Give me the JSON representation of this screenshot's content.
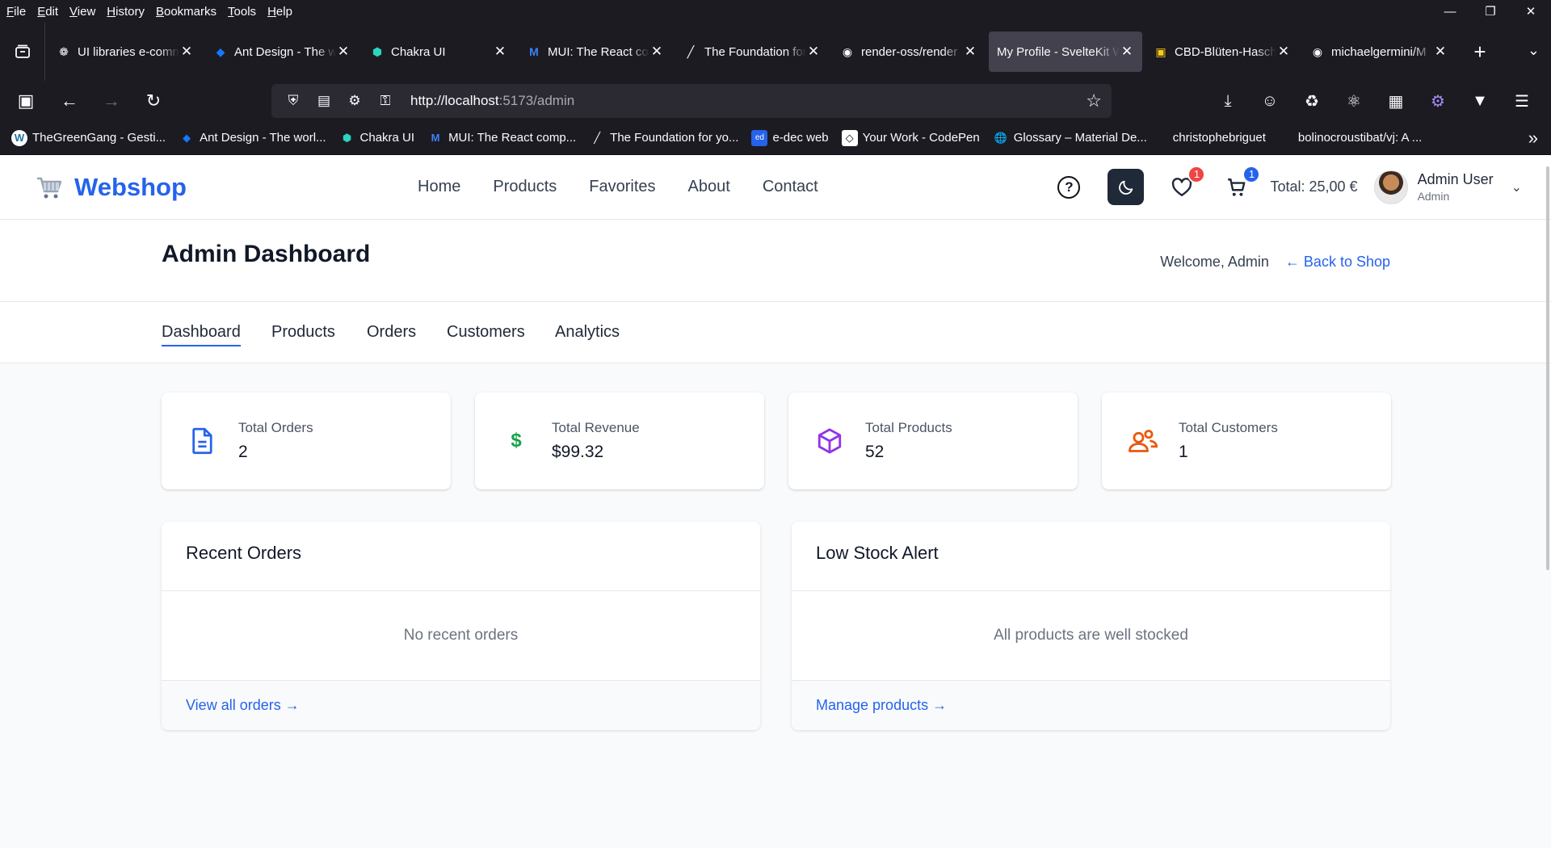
{
  "browser": {
    "menu": [
      "File",
      "Edit",
      "View",
      "History",
      "Bookmarks",
      "Tools",
      "Help"
    ],
    "tabs": [
      {
        "label": "UI libraries e-commerce",
        "icon": "openai-icon",
        "active": false
      },
      {
        "label": "Ant Design - The world",
        "icon": "ant-design-icon",
        "active": false
      },
      {
        "label": "Chakra UI",
        "icon": "chakra-icon",
        "active": false
      },
      {
        "label": "MUI: The React component",
        "icon": "mui-icon",
        "active": false
      },
      {
        "label": "The Foundation for your",
        "icon": "shadcn-icon",
        "active": false
      },
      {
        "label": "render-oss/render",
        "icon": "github-icon",
        "active": false
      },
      {
        "label": "My Profile - SvelteKit Webshop",
        "icon": "sveltekit-icon",
        "active": true
      },
      {
        "label": "CBD-Blüten-Haschisch",
        "icon": "shop-icon",
        "active": false
      },
      {
        "label": "michaelgermini/M",
        "icon": "github-icon",
        "active": false
      }
    ],
    "url": {
      "host": "http://localhost",
      "rest": ":5173/admin"
    },
    "bookmarks": [
      {
        "label": "TheGreenGang - Gesti...",
        "icon": "wordpress-icon"
      },
      {
        "label": "Ant Design - The worl...",
        "icon": "ant-design-icon"
      },
      {
        "label": "Chakra UI",
        "icon": "chakra-icon"
      },
      {
        "label": "MUI: The React comp...",
        "icon": "mui-icon"
      },
      {
        "label": "The Foundation for yo...",
        "icon": "shadcn-icon"
      },
      {
        "label": "e-dec web",
        "icon": "edec-icon"
      },
      {
        "label": "Your Work - CodePen",
        "icon": "codepen-icon"
      },
      {
        "label": "Glossary – Material De...",
        "icon": "globe-icon"
      },
      {
        "label": "christophebriguet",
        "icon": ""
      },
      {
        "label": "bolinocroustibat/vj: A ...",
        "icon": ""
      }
    ]
  },
  "header": {
    "logo": "Webshop",
    "nav": [
      "Home",
      "Products",
      "Favorites",
      "About",
      "Contact"
    ],
    "favorites_count": "1",
    "cart_count": "1",
    "cart_total": "Total: 25,00 €",
    "user_name": "Admin User",
    "user_role": "Admin"
  },
  "admin": {
    "title": "Admin Dashboard",
    "welcome": "Welcome, Admin",
    "back_link": "← Back to Shop",
    "tabs": [
      "Dashboard",
      "Products",
      "Orders",
      "Customers",
      "Analytics"
    ],
    "stats": [
      {
        "label": "Total Orders",
        "value": "2",
        "icon": "document-icon",
        "color": "#2563eb"
      },
      {
        "label": "Total Revenue",
        "value": "$99.32",
        "icon": "dollar-icon",
        "color": "#16a34a"
      },
      {
        "label": "Total Products",
        "value": "52",
        "icon": "cube-icon",
        "color": "#9333ea"
      },
      {
        "label": "Total Customers",
        "value": "1",
        "icon": "users-icon",
        "color": "#ea580c"
      }
    ],
    "recent_orders": {
      "title": "Recent Orders",
      "empty": "No recent orders",
      "link": "View all orders →"
    },
    "low_stock": {
      "title": "Low Stock Alert",
      "empty": "All products are well stocked",
      "link": "Manage products →"
    }
  },
  "colors": {
    "accent": "#2563eb",
    "badge_red": "#ef4444"
  }
}
